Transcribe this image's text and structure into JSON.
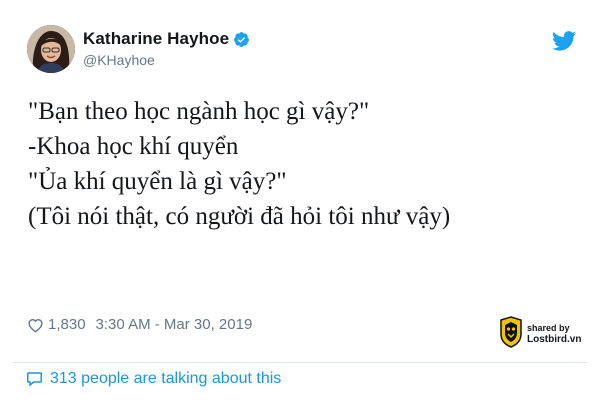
{
  "author": {
    "name": "Katharine Hayhoe",
    "handle": "@KHayhoe"
  },
  "icons": {
    "verified": "verified-badge-icon",
    "twitter": "twitter-bird-icon",
    "heart": "heart-icon",
    "comment": "speech-bubble-icon"
  },
  "tweet": {
    "text": "\"Bạn theo học ngành học gì vậy?\"\n-Khoa học khí quyển\n\"Ủa khí quyển là gì vậy?\"\n(Tôi nói thật, có người đã hỏi tôi như vậy)"
  },
  "meta": {
    "likes": "1,830",
    "timestamp": "3:30 AM - Mar 30, 2019"
  },
  "watermark": {
    "line1": "shared by",
    "line2": "Lostbird.vn"
  },
  "footer": {
    "talking": "313 people are talking about this"
  },
  "colors": {
    "twitter_blue": "#1da1f2",
    "link_blue": "#1b95e0",
    "text": "#14171a",
    "muted": "#657786"
  }
}
